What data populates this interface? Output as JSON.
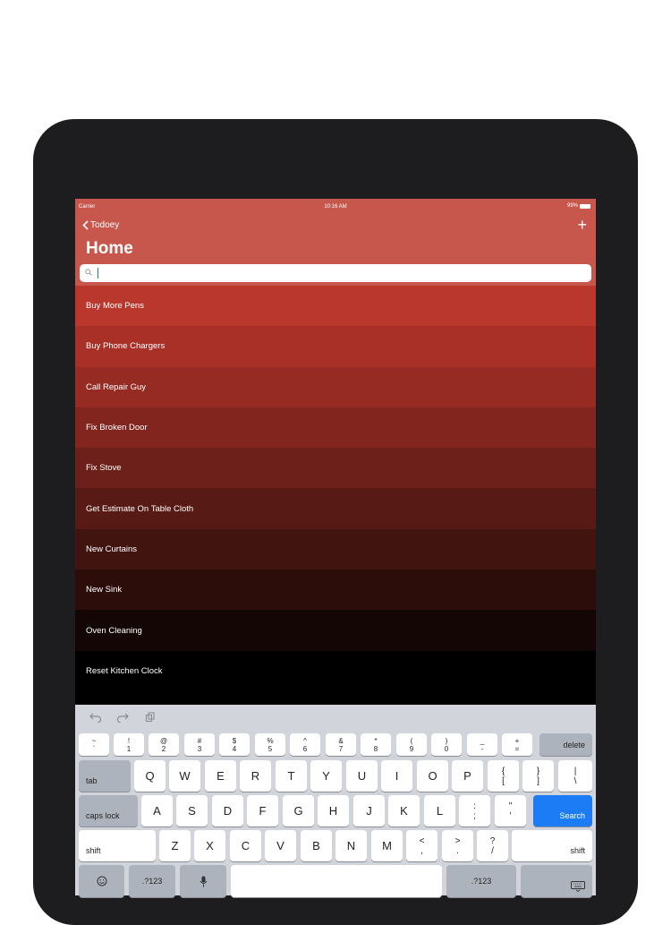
{
  "status_bar": {
    "carrier": "Carrier",
    "time": "10:16 AM",
    "battery": "99%"
  },
  "nav": {
    "back_label": "Todoey",
    "title": "Home",
    "add_label": "+"
  },
  "search": {
    "value": "",
    "placeholder": ""
  },
  "items": [
    {
      "label": "Buy More Pens",
      "color": "#b9372c"
    },
    {
      "label": "Buy Phone Chargers",
      "color": "#a93027"
    },
    {
      "label": "Call Repair Guy",
      "color": "#952b22"
    },
    {
      "label": "Fix Broken Door",
      "color": "#81251e"
    },
    {
      "label": "Fix Stove",
      "color": "#6d1f19"
    },
    {
      "label": "Get Estimate On Table Cloth",
      "color": "#581a14"
    },
    {
      "label": "New Curtains",
      "color": "#421410"
    },
    {
      "label": "New Sink",
      "color": "#2c0d0a"
    },
    {
      "label": "Oven Cleaning",
      "color": "#130604"
    },
    {
      "label": "Reset Kitchen Clock",
      "color": "#000000"
    }
  ],
  "keyboard": {
    "number_row": [
      {
        "top": "~",
        "bottom": "`"
      },
      {
        "top": "!",
        "bottom": "1"
      },
      {
        "top": "@",
        "bottom": "2"
      },
      {
        "top": "#",
        "bottom": "3"
      },
      {
        "top": "$",
        "bottom": "4"
      },
      {
        "top": "%",
        "bottom": "5"
      },
      {
        "top": "^",
        "bottom": "6"
      },
      {
        "top": "&",
        "bottom": "7"
      },
      {
        "top": "*",
        "bottom": "8"
      },
      {
        "top": "(",
        "bottom": "9"
      },
      {
        "top": ")",
        "bottom": "0"
      },
      {
        "top": "_",
        "bottom": "-"
      },
      {
        "top": "+",
        "bottom": "="
      }
    ],
    "delete": "delete",
    "tab": "tab",
    "row_q": [
      "Q",
      "W",
      "E",
      "R",
      "T",
      "Y",
      "U",
      "I",
      "O",
      "P"
    ],
    "row_q_extra": [
      {
        "top": "{",
        "bottom": "["
      },
      {
        "top": "}",
        "bottom": "]"
      },
      {
        "top": "|",
        "bottom": "\\"
      }
    ],
    "caps_lock": "caps lock",
    "row_a": [
      "A",
      "S",
      "D",
      "F",
      "G",
      "H",
      "J",
      "K",
      "L"
    ],
    "row_a_extra": [
      {
        "top": ":",
        "bottom": ";"
      },
      {
        "top": "\"",
        "bottom": "'"
      }
    ],
    "search": "Search",
    "shift": "shift",
    "row_z": [
      "Z",
      "X",
      "C",
      "V",
      "B",
      "N",
      "M"
    ],
    "row_z_extra": [
      {
        "top": "<",
        "bottom": ","
      },
      {
        "top": ">",
        "bottom": "."
      },
      {
        "top": "?",
        "bottom": "/"
      }
    ],
    "numbers_label": ".?123",
    "colors": {
      "search_key": "#1b7cf5",
      "keyboard_bg": "#d1d4da"
    }
  }
}
